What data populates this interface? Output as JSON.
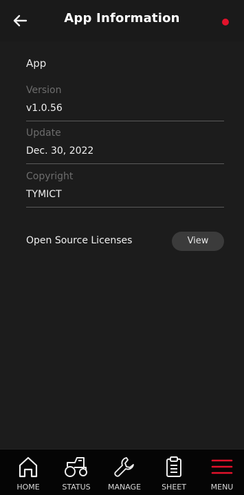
{
  "header": {
    "title": "App Information",
    "back_icon": "arrow-left-icon",
    "status_color": "#e3122b"
  },
  "content": {
    "section_title": "App",
    "fields": [
      {
        "label": "Version",
        "value": "v1.0.56"
      },
      {
        "label": "Update",
        "value": "Dec. 30, 2022"
      },
      {
        "label": "Copyright",
        "value": "TYMICT"
      }
    ],
    "licenses": {
      "label": "Open Source Licenses",
      "button": "View"
    }
  },
  "nav": {
    "items": [
      {
        "label": "HOME",
        "icon": "home-icon"
      },
      {
        "label": "STATUS",
        "icon": "tractor-icon"
      },
      {
        "label": "MANAGE",
        "icon": "wrench-icon"
      },
      {
        "label": "SHEET",
        "icon": "clipboard-icon"
      },
      {
        "label": "MENU",
        "icon": "hamburger-menu-icon",
        "active": true
      }
    ]
  },
  "colors": {
    "background": "#1c1c1c",
    "accent": "#e3122b",
    "divider": "#5a5a5a"
  }
}
